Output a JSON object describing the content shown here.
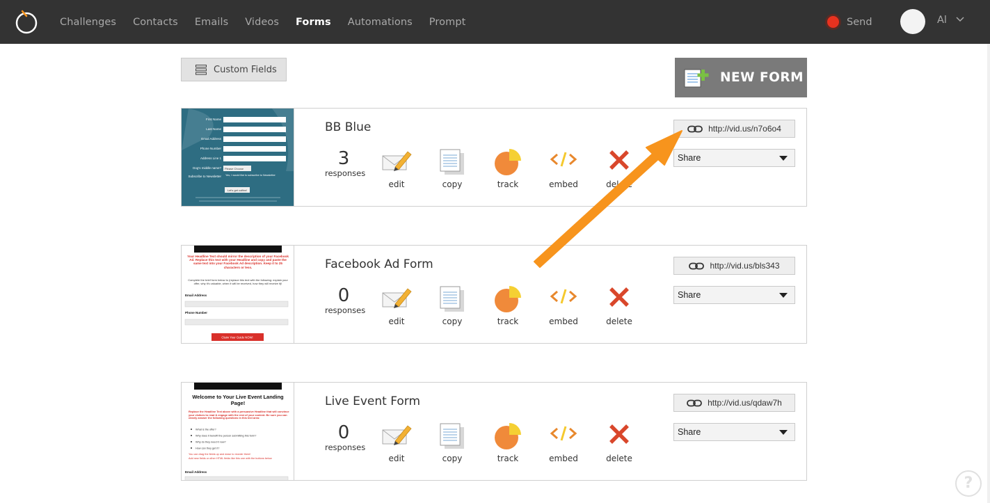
{
  "nav": {
    "items": [
      "Challenges",
      "Contacts",
      "Emails",
      "Videos",
      "Forms",
      "Automations",
      "Prompt"
    ],
    "active": "Forms",
    "send_label": "Send",
    "user_label": "Al"
  },
  "toolbar": {
    "custom_fields_label": "Custom Fields",
    "new_form_label": "NEW FORM"
  },
  "forms": [
    {
      "name": "BB Blue",
      "responses": "3",
      "responses_label": "responses",
      "url": "http://vid.us/n7o6o4",
      "share_label": "Share",
      "thumb_fields": [
        "First Name",
        "Last Name",
        "Email Address",
        "Phone Number",
        "Address Line 1",
        "Dog's middle name?",
        "Subscribe to Newsletter"
      ],
      "thumb_select": "Please Choose",
      "thumb_checkbox": "Yes, I would like to subscribe to Newsletter",
      "thumb_button": "Let's get coffee!"
    },
    {
      "name": "Facebook Ad Form",
      "responses": "0",
      "responses_label": "responses",
      "url": "http://vid.us/bls343",
      "share_label": "Share",
      "thumb_headline": "Your Headline Text should mirror the description of your Facebook Ad. Replace this text with your Headline and copy and paste the same text into your Facebook Ad description. Keep it to 25 characters or less.",
      "thumb_body": "Complete the brief form below to (replace this text with the following: explain your offer, why it's valuable, when it will be received, how they will receive it)!",
      "thumb_fields": [
        "Email Address",
        "Phone Number"
      ],
      "thumb_button": "Claim Your Guide NOW!"
    },
    {
      "name": "Live Event Form",
      "responses": "0",
      "responses_label": "responses",
      "url": "http://vid.us/qdaw7h",
      "share_label": "Share",
      "thumb_title": "Welcome to Your Live Event Landing Page!",
      "thumb_intro": "Replace the Headline Text above with a persuasive Headline that will convince your visitors to read & engage with the rest of your content. Be sure you can clearly answer the following questions in this text area:",
      "thumb_bullets": [
        "What is the offer?",
        "Why does it benefit the person submitting this form?",
        "Why do they need it now?",
        "How can they get it?"
      ],
      "thumb_note1": "You can drag the fields up and down to reorder them!",
      "thumb_note2": "Add new fields or other HTML fields like this one with the buttons below",
      "thumb_fields": [
        "Email Address"
      ]
    }
  ],
  "actions": [
    "edit",
    "copy",
    "track",
    "embed",
    "delete"
  ],
  "help_label": "?",
  "colors": {
    "topbar": "#333333",
    "send_dot": "#e8321f",
    "arrow": "#f7941d",
    "delete": "#d9472b",
    "track": "#f08a3a",
    "embed": "#e8882d"
  }
}
